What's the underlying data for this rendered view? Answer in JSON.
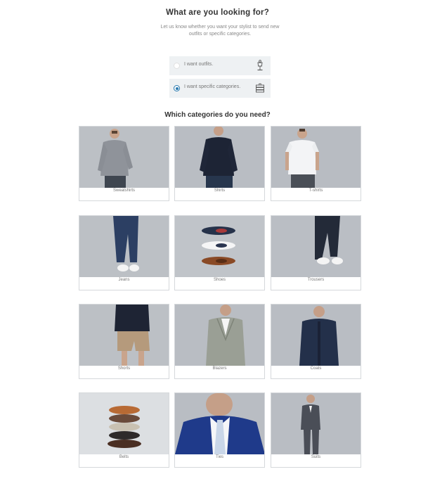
{
  "header": {
    "title": "What are you looking for?",
    "subtitle": "Let us know whether you want your stylist to send new outfits or specific categories."
  },
  "options": [
    {
      "label": "I want outfits.",
      "icon": "mannequin-icon",
      "selected": false
    },
    {
      "label": "I want specific categories.",
      "icon": "clothes-stack-icon",
      "selected": true
    }
  ],
  "categories_title": "Which categories do you need?",
  "categories": [
    {
      "label": "Sweatshirts"
    },
    {
      "label": "Shirts"
    },
    {
      "label": "T-shirts"
    },
    {
      "label": "Jeans"
    },
    {
      "label": "Shoes"
    },
    {
      "label": "Trousers"
    },
    {
      "label": "Shorts"
    },
    {
      "label": "Blazers"
    },
    {
      "label": "Coats"
    },
    {
      "label": "Belts"
    },
    {
      "label": "Ties"
    },
    {
      "label": "Suits"
    }
  ],
  "colors": {
    "accent": "#2a7ab0",
    "option_bg": "#eef1f3",
    "photo_bg": "#b7bcc2"
  }
}
